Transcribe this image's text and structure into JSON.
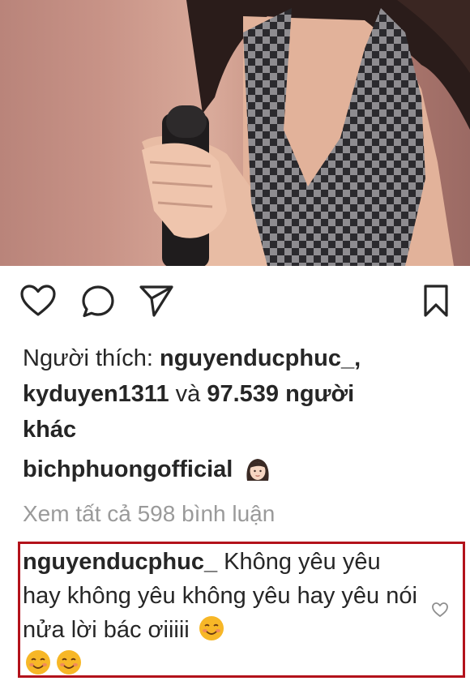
{
  "post": {
    "likes": {
      "prefix": "Người thích:",
      "user1": "nguyenducphuc_,",
      "user2": "kyduyen1311",
      "connector": "và",
      "count": "97.539 người",
      "suffix": "khác"
    },
    "caption": {
      "username": "bichphuongofficial",
      "emoji": "woman-face-emoji"
    },
    "view_all_comments": "Xem tất cả 598 bình luận",
    "comment": {
      "username": "nguyenducphuc_",
      "text": " Không yêu yêu hay không yêu không yêu hay yêu nói nửa lời bác ơiiiii",
      "emojis": [
        "smiling-face-emoji",
        "smiling-face-emoji",
        "smiling-face-emoji"
      ]
    }
  },
  "icons": {
    "like": "heart-icon",
    "comment": "comment-bubble-icon",
    "share": "paper-plane-icon",
    "save": "bookmark-icon",
    "comment_like": "small-heart-icon"
  },
  "colors": {
    "text": "#262626",
    "muted": "#9a9a9a",
    "highlight_border": "#b3121b"
  }
}
